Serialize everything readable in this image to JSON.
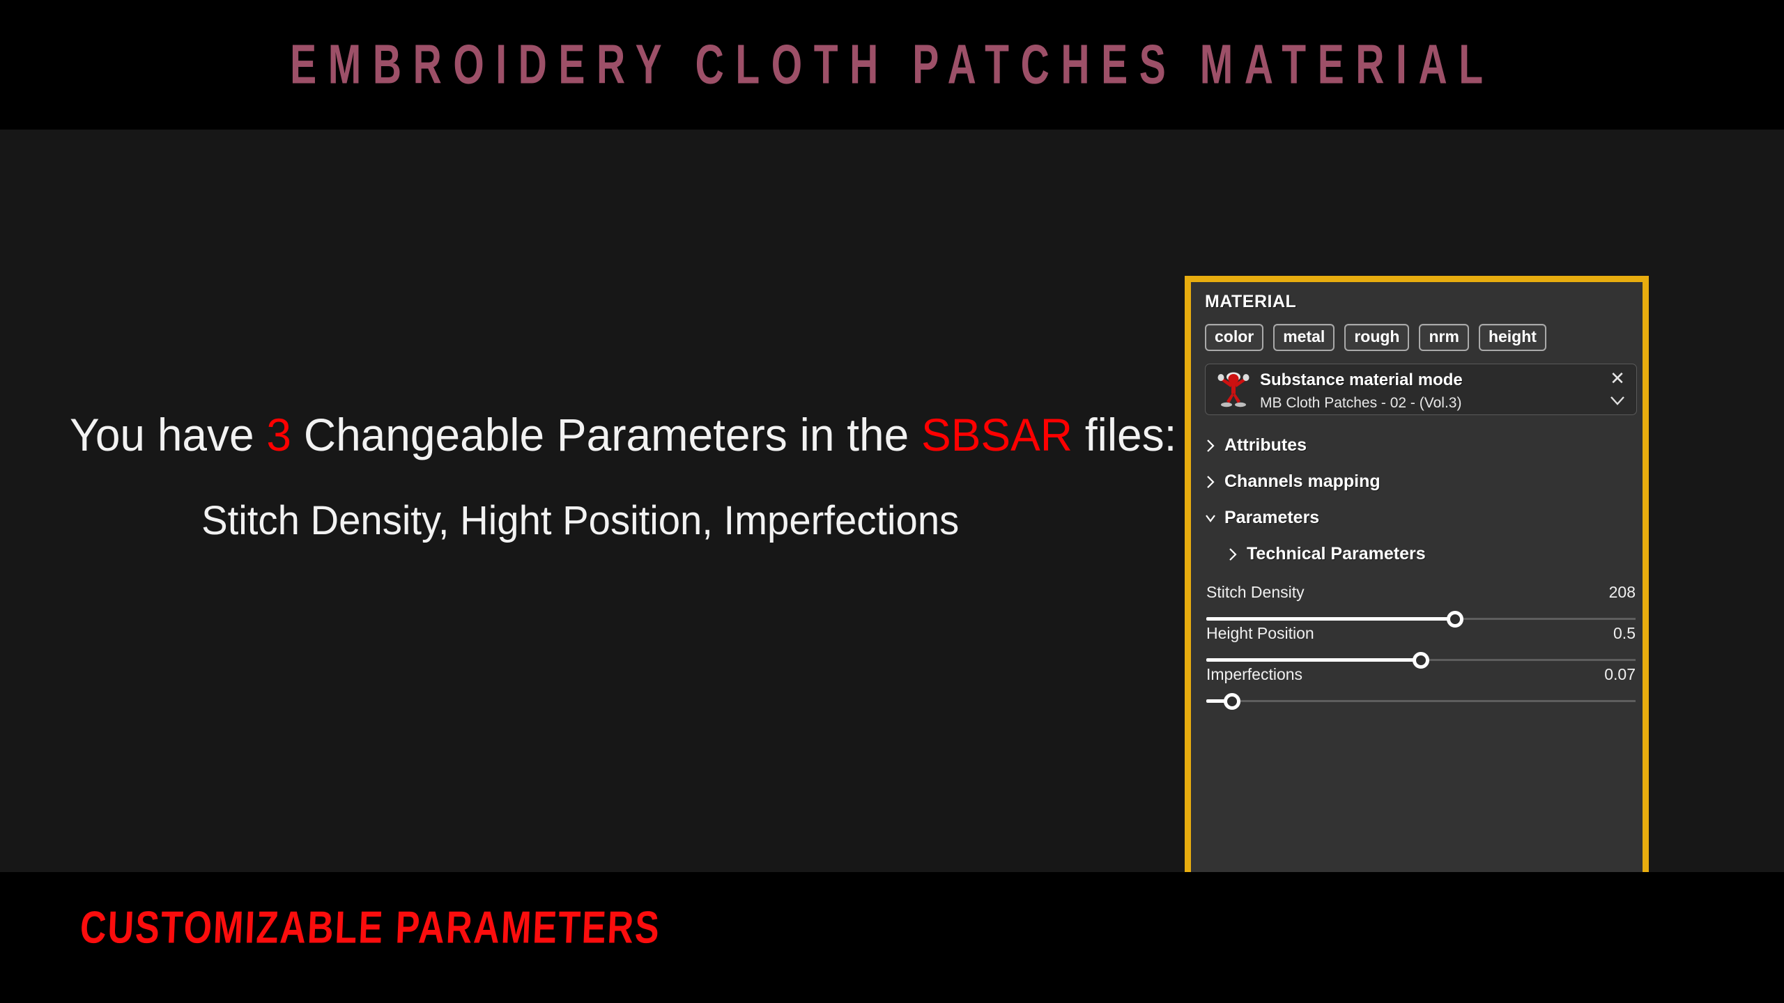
{
  "header": {
    "title": "EMBROIDERY CLOTH PATCHES MATERIAL",
    "title_color": "#9d5068",
    "band_color": "#000000"
  },
  "body": {
    "line1_part1": "You have ",
    "line1_highlight1": "3",
    "line1_part2": " Changeable Parameters in the ",
    "line1_highlight2": "SBSAR",
    "line1_part3": " files:",
    "line2": "Stitch Density, Hight Position, Imperfections",
    "highlight_color": "#ff0000",
    "text_color": "#f2f2f2",
    "background_color": "#171717"
  },
  "footer": {
    "text": "CUSTOMIZABLE PARAMETERS",
    "color": "#fb0d0d",
    "band_color": "#000000"
  },
  "panel": {
    "border_color": "#e8ad0f",
    "background_color": "#333333",
    "title": "MATERIAL",
    "channel_buttons": [
      {
        "label": "color"
      },
      {
        "label": "metal"
      },
      {
        "label": "rough"
      },
      {
        "label": "nrm"
      },
      {
        "label": "height"
      }
    ],
    "substance": {
      "icon": "substance-figure-icon",
      "title": "Substance material mode",
      "preset": "MB Cloth Patches - 02 - (Vol.3)",
      "close_icon": "close-icon",
      "dropdown_icon": "chevron-down-icon"
    },
    "sections": [
      {
        "label": "Attributes",
        "expanded": false,
        "icon": "chevron-right-icon"
      },
      {
        "label": "Channels mapping",
        "expanded": false,
        "icon": "chevron-right-icon"
      },
      {
        "label": "Parameters",
        "expanded": true,
        "icon": "chevron-down-icon"
      },
      {
        "label": "Technical Parameters",
        "expanded": false,
        "icon": "chevron-right-icon"
      }
    ],
    "parameters": [
      {
        "name": "Stitch Density",
        "value": "208",
        "percent": 58
      },
      {
        "name": "Height Position",
        "value": "0.5",
        "percent": 50
      },
      {
        "name": "Imperfections",
        "value": "0.07",
        "percent": 6
      }
    ]
  }
}
